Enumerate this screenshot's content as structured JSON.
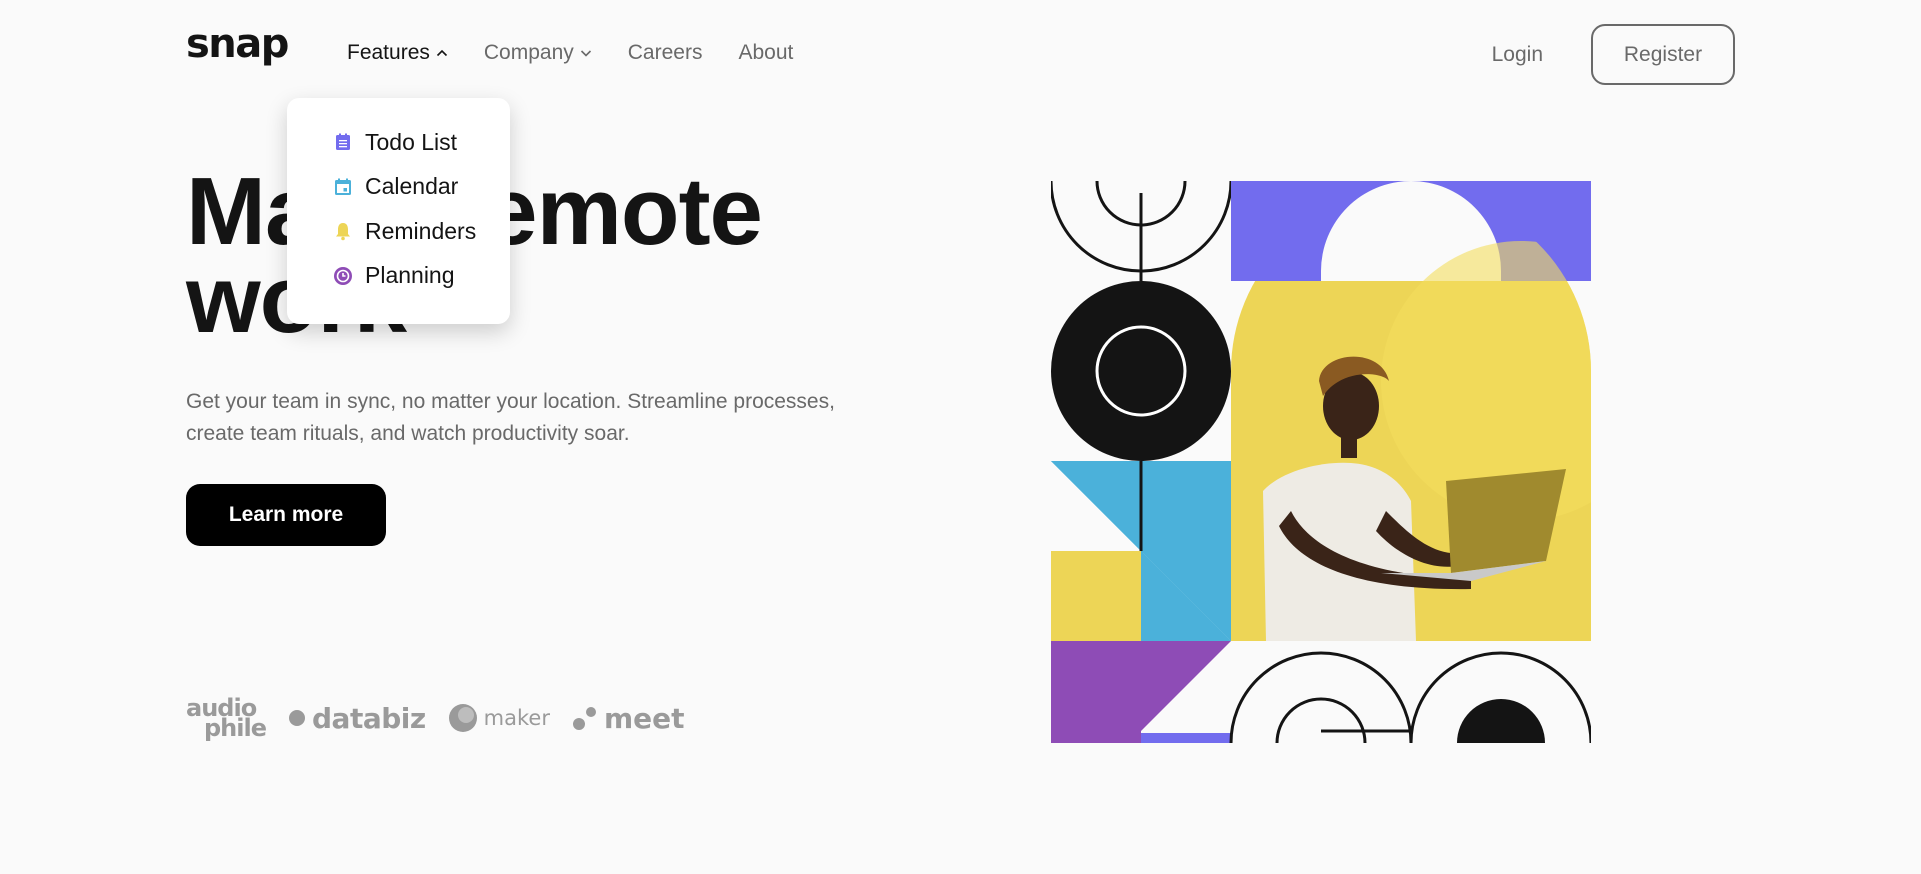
{
  "header": {
    "logo": "snap",
    "nav": [
      {
        "label": "Features",
        "active": true,
        "has_dropdown": true,
        "expanded": true
      },
      {
        "label": "Company",
        "active": false,
        "has_dropdown": true,
        "expanded": false
      },
      {
        "label": "Careers",
        "active": false,
        "has_dropdown": false
      },
      {
        "label": "About",
        "active": false,
        "has_dropdown": false
      }
    ],
    "login_label": "Login",
    "register_label": "Register"
  },
  "features_dropdown": {
    "items": [
      {
        "label": "Todo List",
        "icon": "todo-list-icon",
        "color": "#726CEE"
      },
      {
        "label": "Calendar",
        "icon": "calendar-icon",
        "color": "#4BB1DA"
      },
      {
        "label": "Reminders",
        "icon": "bell-icon",
        "color": "#EDD556"
      },
      {
        "label": "Planning",
        "icon": "clock-icon",
        "color": "#8E4CB6"
      }
    ]
  },
  "hero": {
    "title_line1": "Make remote",
    "title_line2": "work",
    "subtitle": "Get your team in sync, no matter your location. Streamline processes, create team rituals, and watch productivity soar.",
    "cta_label": "Learn more"
  },
  "clients": {
    "audiophile_top": "audio",
    "audiophile_bottom": "phile",
    "databiz": "databiz",
    "maker": "maker",
    "meet": "meet"
  },
  "colors": {
    "background": "#FAFAFA",
    "text_dark": "#141414",
    "text_gray": "#696969",
    "accent_purple": "#726CEE",
    "accent_blue": "#4BB1DA",
    "accent_yellow": "#EDD556",
    "accent_violet": "#8E4CB6"
  }
}
